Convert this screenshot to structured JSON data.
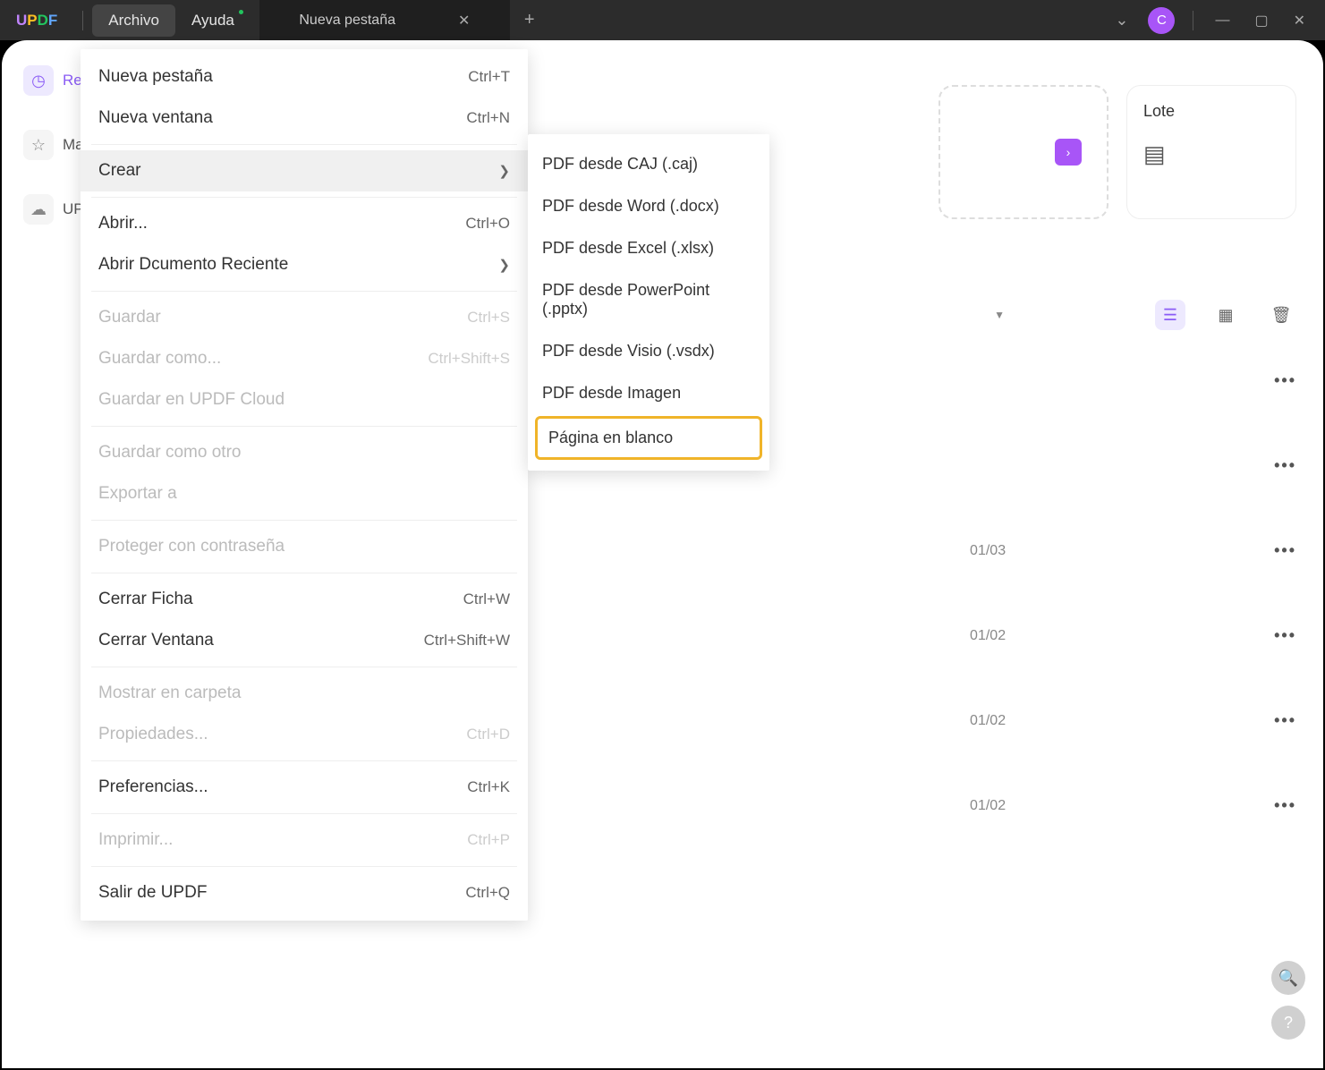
{
  "titlebar": {
    "logo": {
      "u": "U",
      "p": "P",
      "d": "D",
      "f": "F"
    },
    "menu_archivo": "Archivo",
    "menu_ayuda": "Ayuda",
    "tab_title": "Nueva pestaña",
    "avatar_letter": "C"
  },
  "sidebar": {
    "items": [
      {
        "label": "Reci",
        "icon": "◷"
      },
      {
        "label": "Marc",
        "icon": "☆"
      },
      {
        "label": "UPD",
        "icon": "☁"
      }
    ]
  },
  "cards": {
    "lote_title": "Lote"
  },
  "rows": [
    {
      "date": ""
    },
    {
      "date": ""
    },
    {
      "date": "01/03"
    },
    {
      "date": "01/02"
    },
    {
      "date": "01/02"
    },
    {
      "date": "01/02"
    }
  ],
  "dropdown": [
    {
      "label": "Nueva pestaña",
      "short": "Ctrl+T",
      "type": "item"
    },
    {
      "label": "Nueva ventana",
      "short": "Ctrl+N",
      "type": "item"
    },
    {
      "type": "sep"
    },
    {
      "label": "Crear",
      "type": "sub",
      "hover": true
    },
    {
      "type": "sep"
    },
    {
      "label": "Abrir...",
      "short": "Ctrl+O",
      "type": "item"
    },
    {
      "label": "Abrir Dcumento Reciente",
      "type": "sub"
    },
    {
      "type": "sep"
    },
    {
      "label": "Guardar",
      "short": "Ctrl+S",
      "type": "item",
      "disabled": true
    },
    {
      "label": "Guardar como...",
      "short": "Ctrl+Shift+S",
      "type": "item",
      "disabled": true
    },
    {
      "label": "Guardar en UPDF Cloud",
      "type": "item",
      "disabled": true
    },
    {
      "type": "sep"
    },
    {
      "label": "Guardar como otro",
      "type": "item",
      "disabled": true
    },
    {
      "label": "Exportar a",
      "type": "item",
      "disabled": true
    },
    {
      "type": "sep"
    },
    {
      "label": "Proteger con contraseña",
      "type": "item",
      "disabled": true
    },
    {
      "type": "sep"
    },
    {
      "label": "Cerrar Ficha",
      "short": "Ctrl+W",
      "type": "item"
    },
    {
      "label": "Cerrar Ventana",
      "short": "Ctrl+Shift+W",
      "type": "item"
    },
    {
      "type": "sep"
    },
    {
      "label": "Mostrar en carpeta",
      "type": "item",
      "disabled": true
    },
    {
      "label": "Propiedades...",
      "short": "Ctrl+D",
      "type": "item",
      "disabled": true
    },
    {
      "type": "sep"
    },
    {
      "label": "Preferencias...",
      "short": "Ctrl+K",
      "type": "item"
    },
    {
      "type": "sep"
    },
    {
      "label": "Imprimir...",
      "short": "Ctrl+P",
      "type": "item",
      "disabled": true
    },
    {
      "type": "sep"
    },
    {
      "label": "Salir de UPDF",
      "short": "Ctrl+Q",
      "type": "item"
    }
  ],
  "submenu": [
    {
      "label": "PDF desde CAJ (.caj)"
    },
    {
      "label": "PDF desde Word (.docx)"
    },
    {
      "label": "PDF desde Excel (.xlsx)"
    },
    {
      "label": "PDF desde PowerPoint (.pptx)"
    },
    {
      "label": "PDF desde Visio (.vsdx)"
    },
    {
      "label": "PDF desde Imagen"
    },
    {
      "label": "Página en blanco",
      "highlight": true
    }
  ]
}
